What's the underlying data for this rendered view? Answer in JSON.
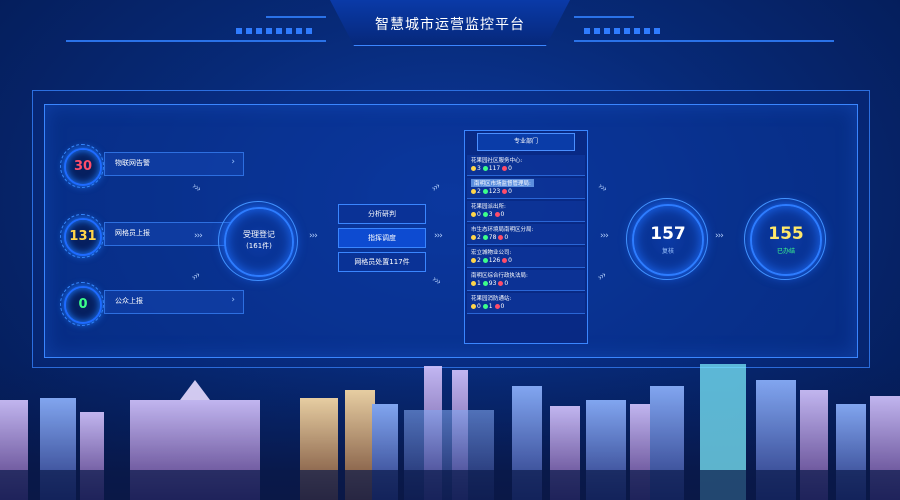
{
  "header": {
    "title": "智慧城市运营监控平台"
  },
  "sources": [
    {
      "count": "30",
      "label": "物联网告警",
      "color": "#ff4d6a"
    },
    {
      "count": "131",
      "label": "网格员上报",
      "color": "#ffd54a"
    },
    {
      "count": "0",
      "label": "公众上报",
      "color": "#3cff8a"
    }
  ],
  "registration": {
    "title": "受理登记",
    "count": "(161件)"
  },
  "analysis": {
    "items": [
      "分析研判",
      "指挥调度",
      "网格员处置117件"
    ]
  },
  "departments": {
    "title": "专业部门",
    "rows": [
      {
        "name": "花果园社区服务中心:",
        "a": "3",
        "b": "117",
        "c": "0"
      },
      {
        "name": "南明区市场监督管理局:",
        "a": "2",
        "b": "123",
        "c": "0"
      },
      {
        "name": "花果园派出所:",
        "a": "0",
        "b": "3",
        "c": "0"
      },
      {
        "name": "市生态环境局南明区分局:",
        "a": "2",
        "b": "78",
        "c": "0"
      },
      {
        "name": "宏立城物业公司:",
        "a": "2",
        "b": "126",
        "c": "0"
      },
      {
        "name": "南明区综合行政执法局:",
        "a": "1",
        "b": "93",
        "c": "0"
      },
      {
        "name": "花果园消防通站:",
        "a": "0",
        "b": "1",
        "c": "0"
      }
    ]
  },
  "resolved": {
    "count": "157",
    "label": "复核"
  },
  "closed": {
    "count": "155",
    "label": "已办结"
  },
  "arrow_glyph": "›››",
  "chevron": "›",
  "colors": {
    "accent": "#2f7cff",
    "warn": "#ff4d6a",
    "yellow": "#ffd54a",
    "green": "#3cff8a"
  }
}
